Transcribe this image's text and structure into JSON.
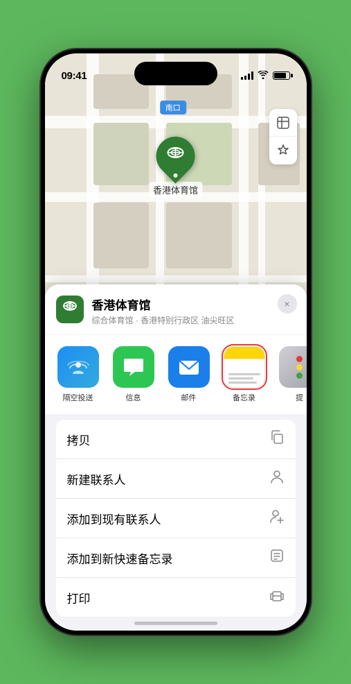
{
  "status": {
    "time": "09:41",
    "location_arrow": "▶"
  },
  "map": {
    "exit_label": "南口",
    "stadium_name": "香港体育馆",
    "stadium_label": "香港体育馆"
  },
  "sheet": {
    "venue_name": "香港体育馆",
    "venue_subtitle": "综合体育馆 · 香港特别行政区 油尖旺区",
    "close_label": "×"
  },
  "share_items": [
    {
      "id": "airdrop",
      "label": "隔空投送",
      "type": "airdrop"
    },
    {
      "id": "message",
      "label": "信息",
      "type": "message"
    },
    {
      "id": "mail",
      "label": "邮件",
      "type": "mail"
    },
    {
      "id": "notes",
      "label": "备忘录",
      "type": "notes",
      "selected": true
    },
    {
      "id": "more",
      "label": "提",
      "type": "more"
    }
  ],
  "actions": [
    {
      "label": "拷贝",
      "icon": "copy"
    },
    {
      "label": "新建联系人",
      "icon": "person"
    },
    {
      "label": "添加到现有联系人",
      "icon": "person-add"
    },
    {
      "label": "添加到新快速备忘录",
      "icon": "note"
    },
    {
      "label": "打印",
      "icon": "print"
    }
  ]
}
